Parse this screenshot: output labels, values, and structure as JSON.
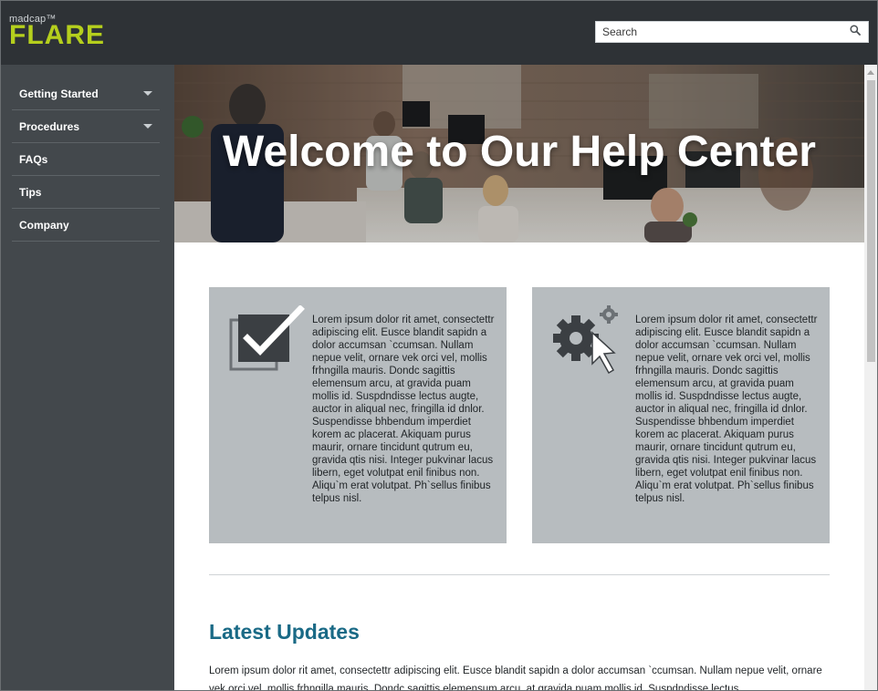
{
  "app": {
    "logo_top": "madcap™",
    "logo_main": "FLARE"
  },
  "search": {
    "placeholder": "Search",
    "icon": "search-icon"
  },
  "sidebar": {
    "items": [
      {
        "label": "Getting Started",
        "has_submenu": true
      },
      {
        "label": "Procedures",
        "has_submenu": true
      },
      {
        "label": "FAQs",
        "has_submenu": false
      },
      {
        "label": "Tips",
        "has_submenu": false
      },
      {
        "label": "Company",
        "has_submenu": false
      }
    ]
  },
  "hero": {
    "title": "Welcome to Our Help Center"
  },
  "cards": [
    {
      "icon": "checkbox-check-icon",
      "text": "Lorem ipsum dolor rit amet, consectettr adipiscing elit. Eusce blandit sapidn a dolor accumsan `ccumsan. Nullam nepue velit, ornare vek orci vel, mollis frhngilla mauris. Dondc sagittis elemensum arcu, at gravida puam mollis id. Suspdndisse lectus augte, auctor in aliqual nec, fringilla id dnlor. Suspendisse bhbendum imperdiet korem ac placerat. Akiquam purus maurir, ornare tincidunt qutrum eu, gravida qtis nisi. Integer pukvinar lacus libern, eget volutpat enil finibus non. Aliqu`m erat volutpat. Ph`sellus finibus telpus nisl."
    },
    {
      "icon": "gears-cursor-icon",
      "text": "Lorem ipsum dolor rit amet, consectettr adipiscing elit. Eusce blandit sapidn a dolor accumsan `ccumsan. Nullam nepue velit, ornare vek orci vel, mollis frhngilla mauris. Dondc sagittis elemensum arcu, at gravida puam mollis id. Suspdndisse lectus augte, auctor in aliqual nec, fringilla id dnlor. Suspendisse bhbendum imperdiet korem ac placerat. Akiquam purus maurir, ornare tincidunt qutrum eu, gravida qtis nisi. Integer pukvinar lacus libern, eget volutpat enil finibus non. Aliqu`m erat volutpat. Ph`sellus finibus telpus nisl."
    }
  ],
  "updates": {
    "title": "Latest Updates",
    "text": "Lorem ipsum dolor rit amet, consectettr adipiscing elit. Eusce blandit sapidn a dolor accumsan `ccumsan. Nullam nepue velit, ornare vek orci vel, mollis frhngilla mauris. Dondc sagittis elemensum arcu, at gravida puam mollis id. Suspdndisse lectus"
  },
  "colors": {
    "header_bg": "#2e3236",
    "sidebar_bg": "#43484c",
    "logo_accent": "#b5cf1d",
    "card_bg": "#b7bcbf",
    "heading_accent": "#1a6a86"
  }
}
